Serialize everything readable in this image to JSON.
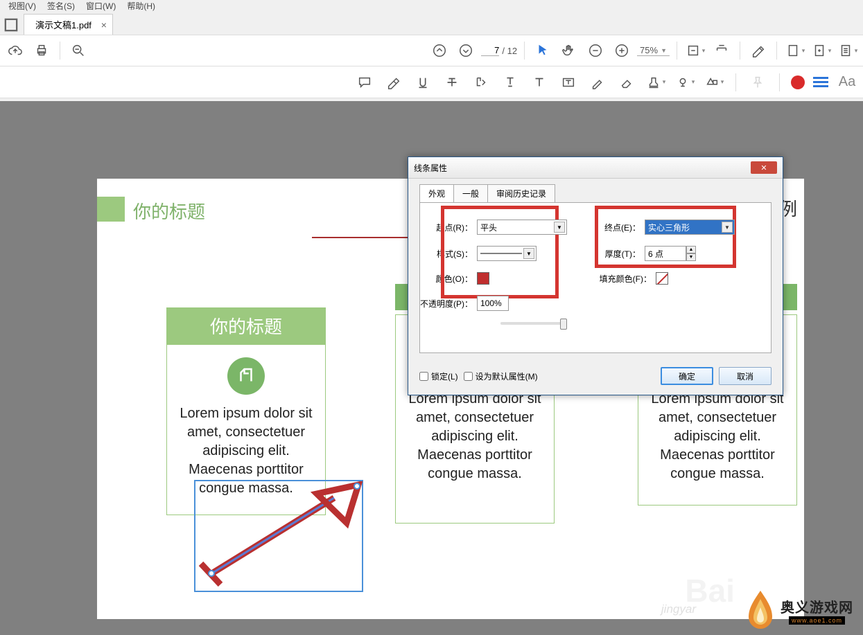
{
  "menu": {
    "view": "视图(V)",
    "sign": "签名(S)",
    "window": "窗口(W)",
    "help": "帮助(H)"
  },
  "tab": {
    "name": "演示文稿1.pdf"
  },
  "toolbar": {
    "page": "7",
    "pages": "/ 12",
    "zoom": "75%"
  },
  "doc": {
    "title": "你的标题",
    "case": "案例",
    "card_title": "你的标题",
    "lorem": "Lorem ipsum dolor sit amet, consectetuer adipiscing elit. Maecenas porttitor congue massa."
  },
  "dialog": {
    "title": "线条属性",
    "tabs": {
      "t1": "外观",
      "t2": "一般",
      "t3": "审阅历史记录"
    },
    "start": "起点(R)：",
    "start_v": "平头",
    "end": "终点(E)：",
    "end_v": "实心三角形",
    "style": "样式(S)：",
    "thick": "厚度(T)：",
    "thick_v": "6 点",
    "color": "颜色(O)：",
    "fill": "填充颜色(F)：",
    "opacity": "不透明度(P)：",
    "opacity_v": "100%",
    "lock": "锁定(L)",
    "default": "设为默认属性(M)",
    "ok": "确定",
    "cancel": "取消"
  },
  "wm": {
    "cn": "奥义游戏网",
    "url": "www.aoe1.com"
  }
}
